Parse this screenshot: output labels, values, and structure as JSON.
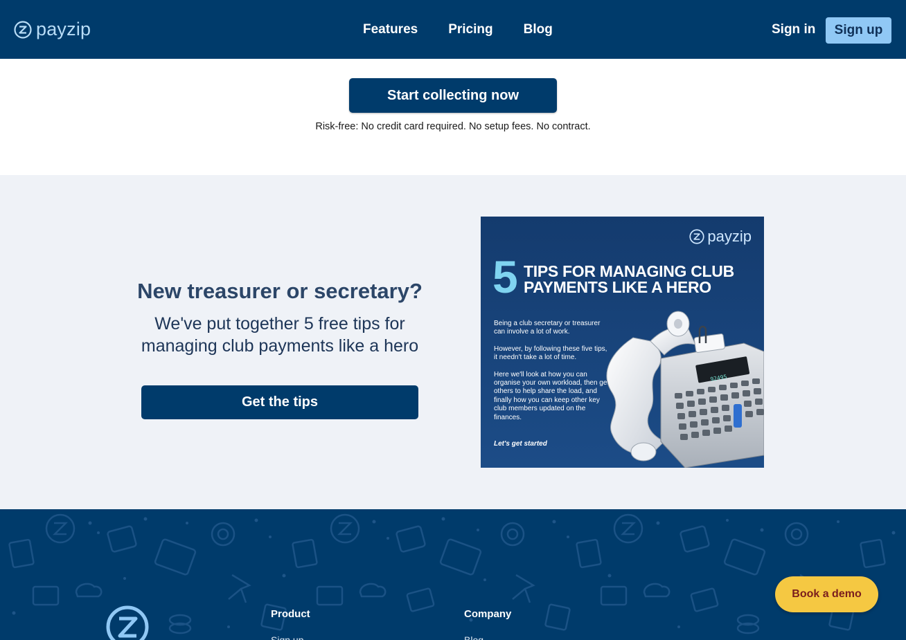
{
  "nav": {
    "logo_text": "payzip",
    "links": [
      "Features",
      "Pricing",
      "Blog"
    ],
    "sign_in": "Sign in",
    "sign_up": "Sign up"
  },
  "cta": {
    "button": "Start collecting now",
    "note": "Risk-free: No credit card required. No setup fees. No contract."
  },
  "tips": {
    "heading": "New treasurer or secretary?",
    "subtitle_line1": "We've put together 5 free tips for",
    "subtitle_line2": "managing club payments like a hero",
    "button": "Get the tips"
  },
  "promo": {
    "logo_text": "payzip",
    "number": "5",
    "title_line1": "TIPS FOR MANAGING CLUB",
    "title_line2": "PAYMENTS LIKE A HERO",
    "para1": "Being a club secretary or treasurer can involve a lot of work.",
    "para2": "However, by following these five tips, it needn't take a lot of time.",
    "para3": "Here we'll look at how you can organise your own workload, then get others to help share the load, and finally how you can keep other key club members updated on the finances.",
    "start": "Let's get started",
    "calculator_display": "92495"
  },
  "footer": {
    "col1_title": "Product",
    "col1_link": "Sign up",
    "col2_title": "Company",
    "col2_link": "Blog"
  },
  "demo": {
    "button": "Book a demo"
  },
  "colors": {
    "navy": "#003b6b",
    "light_blue": "#90c8f5",
    "section_bg": "#eff2f7",
    "demo_yellow": "#f5c842"
  },
  "icons": [
    "payzip-logo-icon",
    "calculator-illustration",
    "footer-pattern"
  ]
}
